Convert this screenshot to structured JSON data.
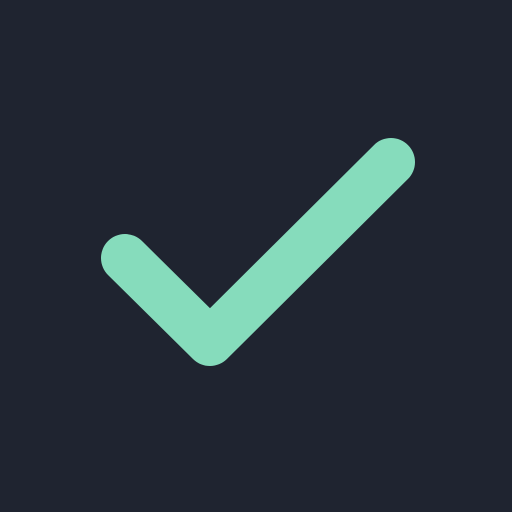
{
  "icon": {
    "name": "checkmark-icon",
    "background_color": "#1f2430",
    "stroke_color": "#86dcbc"
  }
}
